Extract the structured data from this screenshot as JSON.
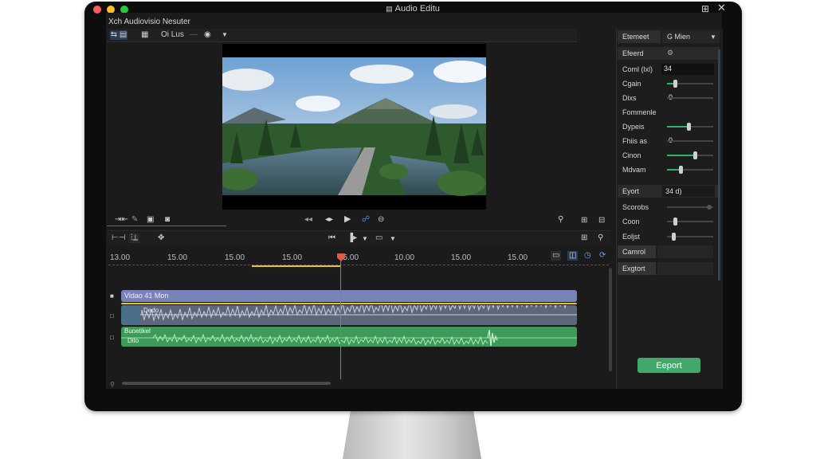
{
  "window": {
    "title": "Audio Editu"
  },
  "left_header": {
    "title": "Xch Audiovisio Nesuter",
    "toolbar_text": "Oi Lus"
  },
  "video": {
    "description_none": ""
  },
  "transport": {
    "play_icon": "play-icon"
  },
  "ruler": {
    "ticks": [
      "13.00",
      "15.00",
      "15.00",
      "15.00",
      "15.00",
      "10.00",
      "15.00",
      "15.00"
    ]
  },
  "tracks": {
    "video_label": "Vidao 41 Mon",
    "audio1_label": "Dedo",
    "audio2_label1": "Buoetikel",
    "audio2_label2": "Dito"
  },
  "inspector": {
    "header_left": "Etemeet",
    "header_right": "G Mien",
    "section1": "Efeerd",
    "rows": [
      {
        "label": "Coml (lxl)",
        "value": "34",
        "level": null
      },
      {
        "label": "Cgain",
        "value": "",
        "level": 0.18
      },
      {
        "label": "Dixs",
        "value": "0",
        "level": 0.0
      },
      {
        "label": "Fommenle",
        "value": "",
        "level": null
      },
      {
        "label": "Dypeis",
        "value": "",
        "level": 0.46
      },
      {
        "label": "Fhiis as",
        "value": "0",
        "level": 0.0
      },
      {
        "label": "Cinon",
        "value": "",
        "level": 0.6
      },
      {
        "label": "Mdvam",
        "value": "",
        "level": 0.3
      }
    ],
    "export_row": {
      "label": "Eyort",
      "value": "34 d)"
    },
    "rows2": [
      {
        "label": "Scorobs",
        "level": 0.9
      },
      {
        "label": "Coon",
        "level": 0.17
      },
      {
        "label": "Eoljst",
        "level": 0.14
      }
    ],
    "btn1": "Camrol",
    "btn2": "Exgtort",
    "export_button": "Eeport"
  },
  "colors": {
    "accent": "#3fa86a",
    "playhead": "#e05a4a",
    "video_clip": "#7a83b8",
    "audio1": "#6f7a8f",
    "audio2": "#3f9a5a"
  }
}
